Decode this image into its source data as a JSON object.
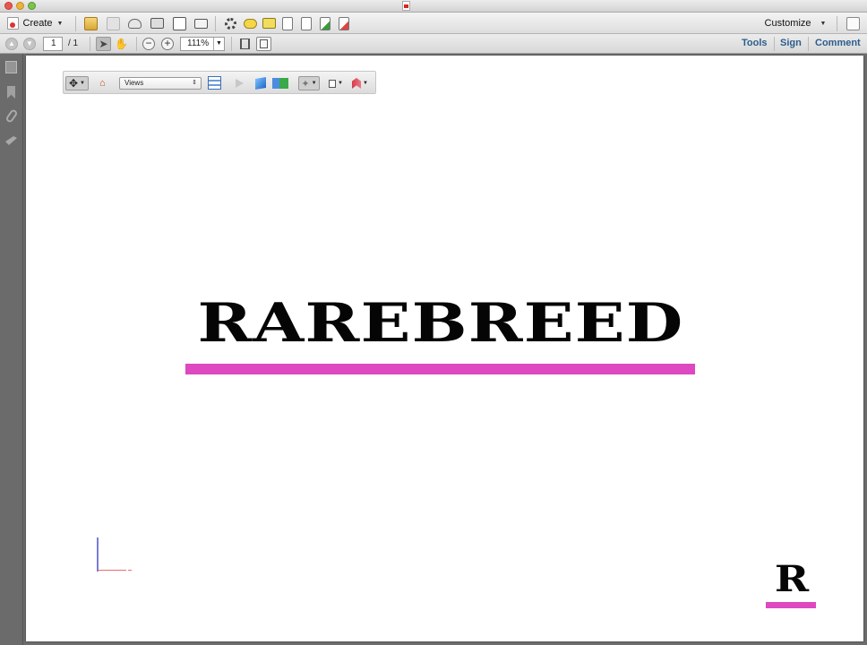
{
  "toolbar": {
    "create_label": "Create",
    "customize_label": "Customize"
  },
  "navigation": {
    "current_page": "1",
    "total_pages": "/ 1",
    "zoom": "111%"
  },
  "panes": {
    "tools": "Tools",
    "sign": "Sign",
    "comment": "Comment"
  },
  "toolbar_3d": {
    "views_select": "Views"
  },
  "document": {
    "wordmark": "RAREBREED",
    "monogram": "R",
    "accent_color": "#de48c0"
  },
  "icons": {
    "main_toolbar": [
      "open-folder-icon",
      "save-icon",
      "cloud-upload-icon",
      "print-icon",
      "edit-icon",
      "email-icon",
      "settings-icon",
      "comment-bubble-icon",
      "highlight-icon",
      "page-stamp-icon",
      "page-search-icon",
      "page-export-icon",
      "page-sign-icon"
    ],
    "sidebar": [
      "pages-icon",
      "bookmark-icon",
      "attachment-icon",
      "signature-icon"
    ]
  }
}
